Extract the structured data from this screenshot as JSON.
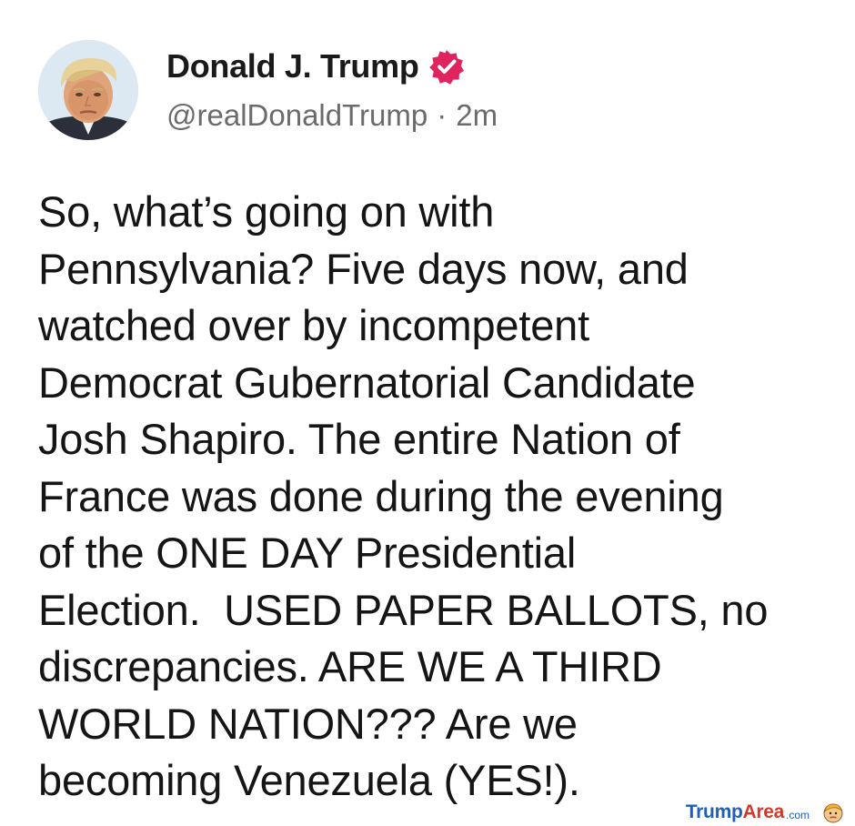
{
  "author": {
    "display_name": "Donald J. Trump",
    "handle": "@realDonaldTrump",
    "separator": "·",
    "time_ago": "2m",
    "avatar_icon": "profile-photo",
    "verified_icon": "verified-badge-icon",
    "verified_color": "#e0245e"
  },
  "post": {
    "lines": [
      "So, what’s going on with",
      "Pennsylvania? Five days now, and",
      "watched over by incompetent",
      "Democrat Gubernatorial Candidate",
      "Josh Shapiro. The entire Nation of",
      "France was done during the evening",
      "of the ONE DAY Presidential",
      "Election.  USED PAPER BALLOTS, no",
      "discrepancies. ARE WE A THIRD",
      "WORLD NATION??? Are we",
      "becoming Venezuela (YES!)."
    ]
  },
  "watermark": {
    "part1": "Trump",
    "part2": "Area",
    "part3": ".com",
    "icon": "trump-caricature-icon",
    "color_blue": "#1f5fb8",
    "color_red": "#d13a2b"
  }
}
